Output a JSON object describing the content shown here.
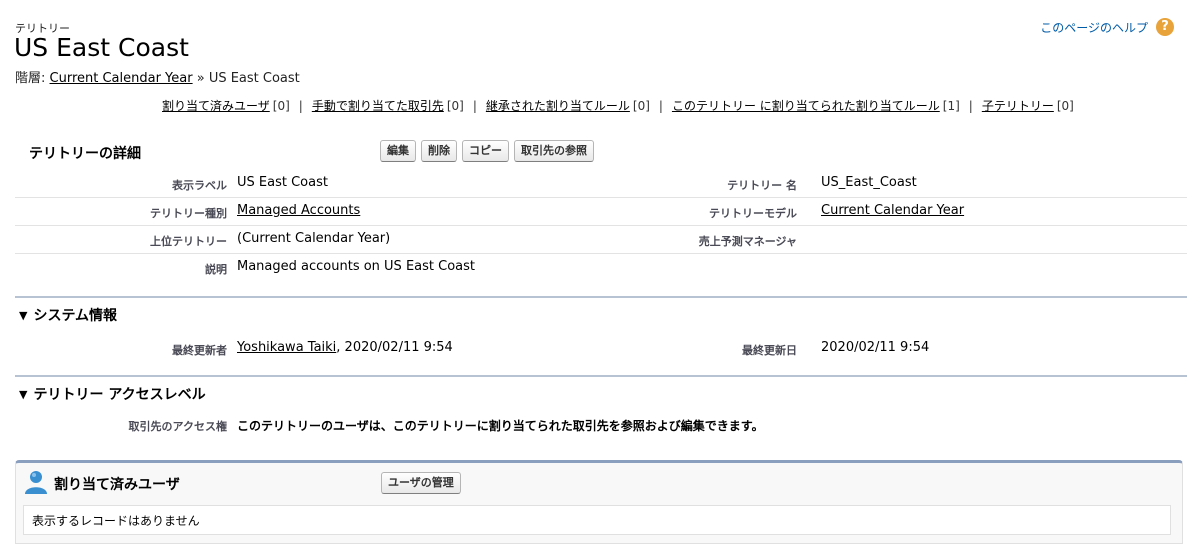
{
  "header": {
    "type_label": "テリトリー",
    "title": "US East Coast",
    "breadcrumb_prefix": "階層: ",
    "breadcrumb_link": "Current Calendar Year",
    "breadcrumb_sep": " » ",
    "breadcrumb_current": "US East Coast",
    "help_link": "このページのヘルプ",
    "help_icon": "?"
  },
  "related_links": [
    {
      "label": "割り当て済みユーザ",
      "count": "[0]"
    },
    {
      "label": "手動で割り当てた取引先",
      "count": "[0]"
    },
    {
      "label": "継承された割り当てルール",
      "count": "[0]"
    },
    {
      "label": "このテリトリー に割り当てられた割り当てルール",
      "count": "[1]"
    },
    {
      "label": "子テリトリー",
      "count": "[0]"
    }
  ],
  "related_sep": "|",
  "detail": {
    "title": "テリトリーの詳細",
    "buttons": {
      "edit": "編集",
      "delete": "削除",
      "copy": "コピー",
      "view_accounts": "取引先の参照"
    },
    "rows": [
      {
        "label1": "表示ラベル",
        "value1": "US East Coast",
        "label2": "テリトリー 名",
        "value2": "US_East_Coast"
      },
      {
        "label1": "テリトリー種別",
        "value1": "Managed Accounts",
        "label2": "テリトリーモデル",
        "value2": "Current Calendar Year"
      },
      {
        "label1": "上位テリトリー",
        "value1": "(Current Calendar Year)",
        "label2": "売上予測マネージャ",
        "value2": ""
      },
      {
        "label1": "説明",
        "value1": "Managed accounts on US East Coast",
        "label2": "",
        "value2": ""
      }
    ]
  },
  "system_info": {
    "title": "システム情報",
    "label1": "最終更新者",
    "user_link": "Yoshikawa Taiki",
    "user_suffix": ", 2020/02/11 9:54",
    "label2": "最終更新日",
    "value2": "2020/02/11 9:54"
  },
  "access_level": {
    "title": "テリトリー アクセスレベル",
    "label": "取引先のアクセス権",
    "value": "このテリトリーのユーザは、このテリトリーに割り当てられた取引先を参照および編集できます。"
  },
  "assigned_users": {
    "title": "割り当て済みユーザ",
    "manage_button": "ユーザの管理",
    "empty_text": "表示するレコードはありません"
  },
  "colors": {
    "accent": "#8a9ebe",
    "help": "#015ba7",
    "help_icon": "#e8a33a",
    "user_icon": "#3a8fd1"
  }
}
